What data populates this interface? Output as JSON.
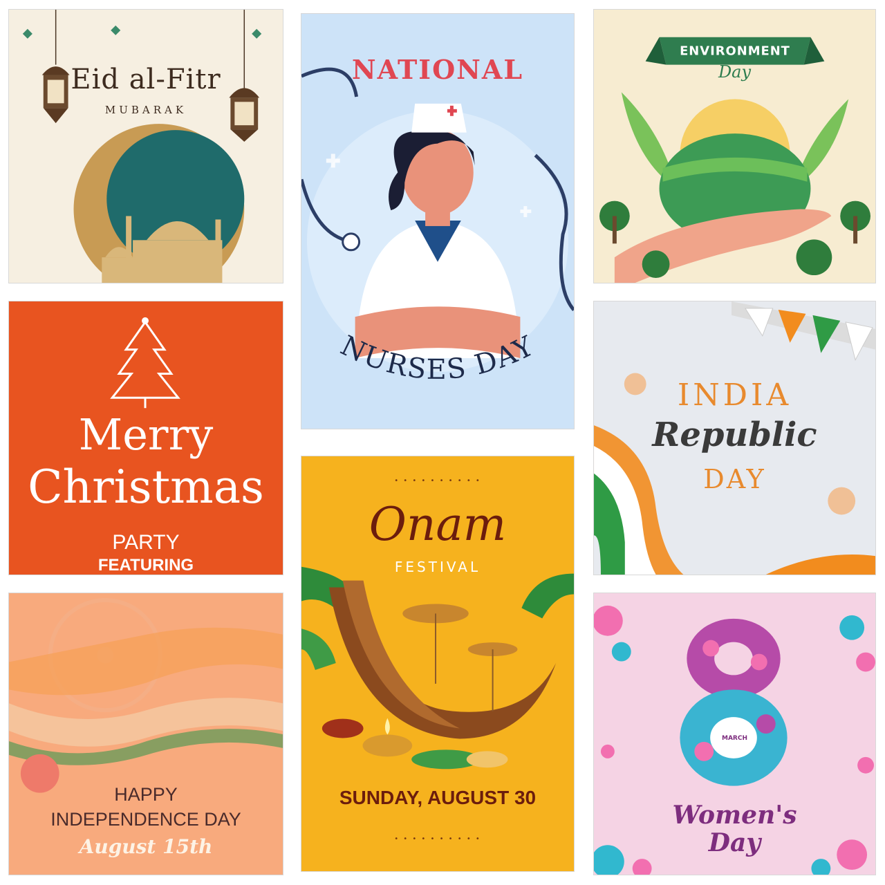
{
  "eid": {
    "title": "Eid al-Fitr",
    "subtitle": "MUBARAK"
  },
  "nurses": {
    "line1": "NATIONAL",
    "line2": "NURSES DAY"
  },
  "environment": {
    "line1": "ENVIRONMENT",
    "line2": "Day"
  },
  "christmas": {
    "line1": "Merry",
    "line2": "Christmas",
    "line3": "PARTY",
    "line4": "FEATURING"
  },
  "republic": {
    "line1": "INDIA",
    "line2": "Republic",
    "line3": "DAY"
  },
  "onam": {
    "title": "Onam",
    "subtitle": "FESTIVAL",
    "date": "SUNDAY, AUGUST 30"
  },
  "independence": {
    "line1": "HAPPY",
    "line2": "INDEPENDENCE DAY",
    "line3": "August 15th"
  },
  "women": {
    "label": "MARCH",
    "line1": "Women's",
    "line2": "Day"
  }
}
